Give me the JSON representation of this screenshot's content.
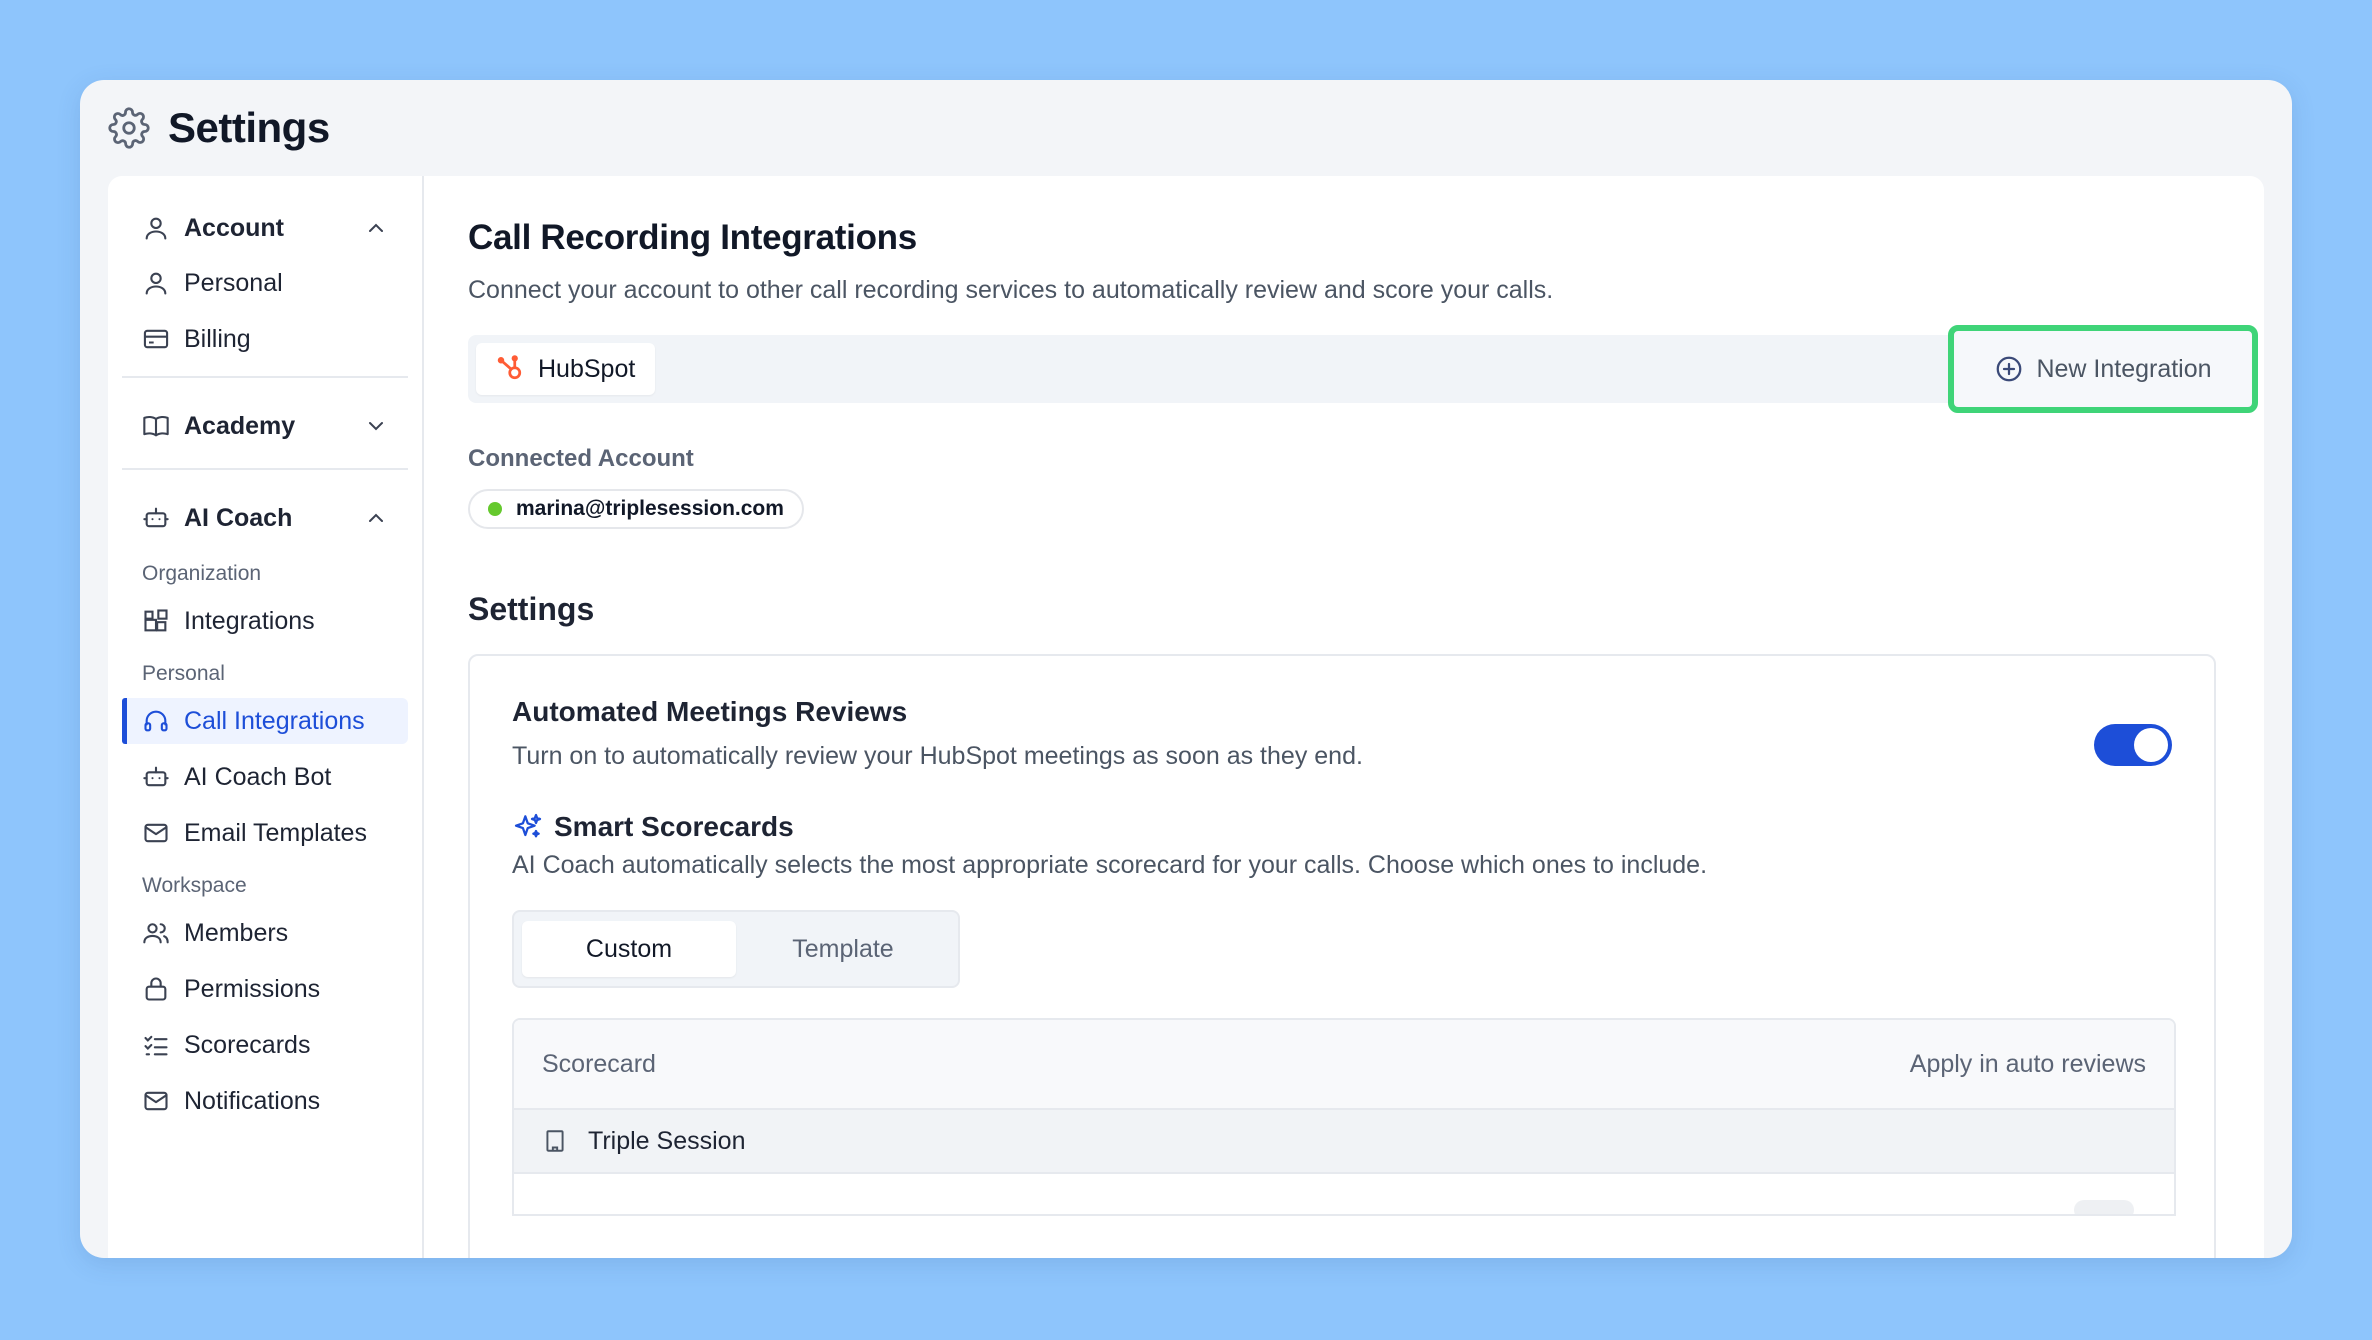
{
  "window": {
    "title": "Settings"
  },
  "sidebar": {
    "account": {
      "label": "Account",
      "items": [
        {
          "label": "Personal"
        },
        {
          "label": "Billing"
        }
      ]
    },
    "academy": {
      "label": "Academy"
    },
    "ai_coach": {
      "label": "AI Coach",
      "groups": {
        "organization": {
          "label": "Organization",
          "items": [
            {
              "label": "Integrations"
            }
          ]
        },
        "personal": {
          "label": "Personal",
          "items": [
            {
              "label": "Call Integrations"
            },
            {
              "label": "AI Coach Bot"
            },
            {
              "label": "Email Templates"
            }
          ]
        },
        "workspace": {
          "label": "Workspace",
          "items": [
            {
              "label": "Members"
            },
            {
              "label": "Permissions"
            },
            {
              "label": "Scorecards"
            },
            {
              "label": "Notifications"
            }
          ]
        }
      }
    }
  },
  "main": {
    "title": "Call Recording Integrations",
    "subtitle": "Connect your account to other call recording services to automatically review and score your calls.",
    "tabs": [
      {
        "label": "HubSpot"
      }
    ],
    "new_integration_label": "New Integration",
    "connected_label": "Connected Account",
    "connected_email": "marina@triplesession.com",
    "settings_title": "Settings",
    "auto_reviews": {
      "title": "Automated Meetings Reviews",
      "desc": "Turn on to automatically review your HubSpot meetings as soon as they end.",
      "enabled": true
    },
    "smart": {
      "title": "Smart Scorecards",
      "desc": "AI Coach automatically selects the most appropriate scorecard for your calls. Choose which ones to include."
    },
    "segment": {
      "custom": "Custom",
      "template": "Template",
      "selected": "Custom"
    },
    "table": {
      "col_scorecard": "Scorecard",
      "col_apply": "Apply in auto reviews",
      "rows": [
        {
          "label": "Triple Session"
        }
      ]
    }
  },
  "colors": {
    "accent": "#1d4ed8",
    "highlight": "#3fd478",
    "hubspot": "#ff5c35",
    "status": "#65c92d"
  }
}
